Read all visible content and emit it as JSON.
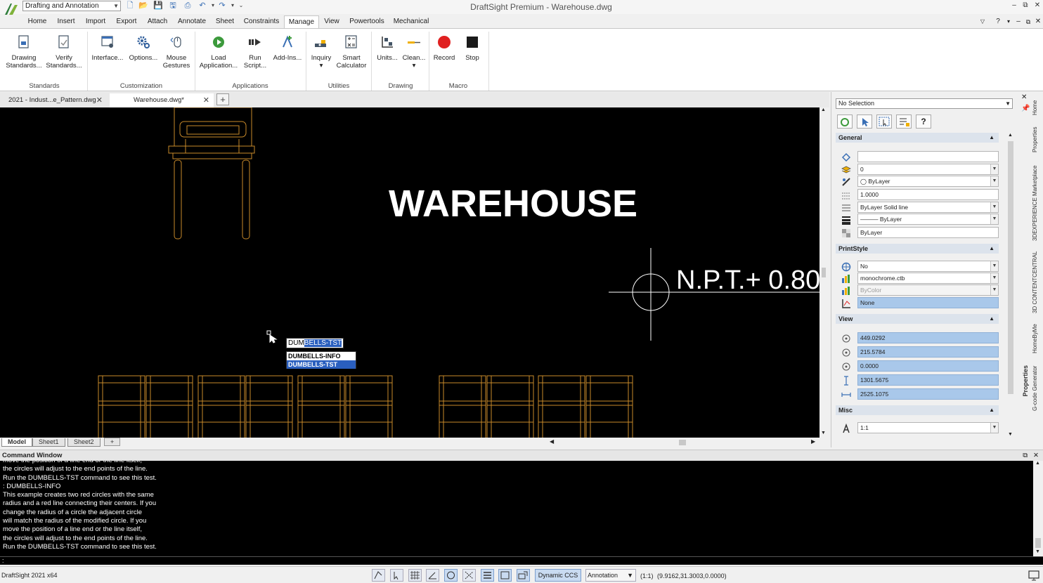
{
  "app": {
    "workspace": "Drafting and Annotation",
    "window_title": "DraftSight Premium - Warehouse.dwg",
    "version": "DraftSight 2021 x64"
  },
  "ribbon_tabs": [
    "Home",
    "Insert",
    "Import",
    "Export",
    "Attach",
    "Annotate",
    "Sheet",
    "Constraints",
    "Manage",
    "View",
    "Powertools",
    "Mechanical"
  ],
  "active_tab": "Manage",
  "ribbon": {
    "buttons": [
      {
        "label1": "Drawing",
        "label2": "Standards...",
        "icon": "drawing-standards-icon"
      },
      {
        "label1": "Verify",
        "label2": "Standards...",
        "icon": "verify-standards-icon"
      },
      {
        "label1": "Interface...",
        "label2": "",
        "icon": "interface-icon"
      },
      {
        "label1": "Options...",
        "label2": "",
        "icon": "options-gear-icon"
      },
      {
        "label1": "Mouse",
        "label2": "Gestures",
        "icon": "mouse-icon"
      },
      {
        "label1": "Load",
        "label2": "Application...",
        "icon": "load-application-icon"
      },
      {
        "label1": "Run",
        "label2": "Script...",
        "icon": "run-script-icon"
      },
      {
        "label1": "Add-Ins...",
        "label2": "",
        "icon": "add-ins-icon"
      },
      {
        "label1": "Inquiry",
        "label2": "▾",
        "icon": "inquiry-icon"
      },
      {
        "label1": "Smart",
        "label2": "Calculator",
        "icon": "calculator-icon"
      },
      {
        "label1": "Units...",
        "label2": "",
        "icon": "units-icon"
      },
      {
        "label1": "Clean...",
        "label2": "▾",
        "icon": "clean-icon"
      },
      {
        "label1": "Record",
        "label2": "",
        "icon": "record-icon"
      },
      {
        "label1": "Stop",
        "label2": "",
        "icon": "stop-icon"
      }
    ],
    "groups": [
      "Standards",
      "Customization",
      "Applications",
      "Utilities",
      "Drawing",
      "Macro"
    ]
  },
  "doc_tabs": [
    {
      "label": "2021 - Indust...e_Pattern.dwg",
      "close": "✕"
    },
    {
      "label": "Warehouse.dwg*",
      "close": "✕"
    }
  ],
  "new_tab": "+",
  "canvas": {
    "title_text": "WAREHOUSE",
    "level_text": "N.P.T.+ 0.80"
  },
  "autocomplete": {
    "typed": "DUM",
    "suggested": "BELLS-TST",
    "items": [
      "DUMBELLS-INFO",
      "DUMBELLS-TST"
    ],
    "selected_index": 1
  },
  "sheet_tabs": [
    "Model",
    "Sheet1",
    "Sheet2"
  ],
  "sheet_add": "+",
  "properties": {
    "selection": "No Selection",
    "sections": {
      "general": "General",
      "printstyle": "PrintStyle",
      "view": "View",
      "misc": "Misc"
    },
    "general": [
      "",
      "0",
      "ByLayer",
      "1.0000",
      "ByLayer     Solid line",
      "——— ByLayer",
      "ByLayer"
    ],
    "printstyle": [
      "No",
      "monochrome.ctb",
      "ByColor",
      "None"
    ],
    "view": [
      "449.0292",
      "215.5784",
      "0.0000",
      "1301.5675",
      "2525.1075"
    ],
    "misc": [
      "1:1"
    ],
    "vertical_label": "Properties"
  },
  "side_tabs": [
    "Home",
    "Properties",
    "3DEXPERIENCE Marketplace",
    "3D CONTENTCENTRAL",
    "HomeByMe",
    "G-code Generator"
  ],
  "command_window": {
    "title": "Command Window",
    "lines": [
      "move the position of a line end or the line itself,",
      "the circles will adjust to the end points of the line.",
      "Run the DUMBELLS-TST command to see this test.",
      ": DUMBELLS-INFO",
      "This example creates two red circles with the same",
      "radius and a red line connecting their centers. If you",
      "change the radius of a circle the adjacent circle",
      "will match the radius of the modified circle. If you",
      "move the position of a line end or the line itself,",
      "the circles will adjust to the end points of the line.",
      "Run the DUMBELLS-TST command to see this test."
    ],
    "prompt": ":"
  },
  "statusbar": {
    "dynamic_ccs": "Dynamic CCS",
    "annotation": "Annotation",
    "scale": "(1:1)",
    "coords": "(9.9162,31.3003,0.0000)"
  },
  "colors": {
    "canvas": "#000000",
    "furniture": "#c98a2a",
    "accent": "#2a5fbf"
  }
}
